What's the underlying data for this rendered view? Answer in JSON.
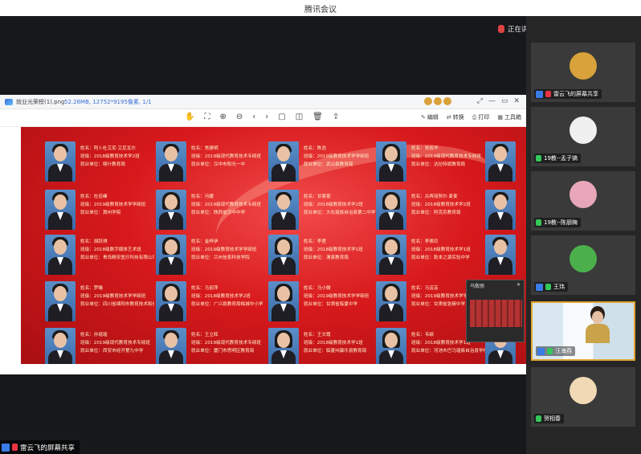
{
  "app": {
    "title": "腾讯会议"
  },
  "speaking": {
    "label": "正在讲话: 汪海燕;"
  },
  "viewer": {
    "file_name": "就业光荣榜(1).png",
    "file_meta": "52.26MB, 12752*9195像素, 1/1",
    "window_controls": [
      "⤢",
      "—",
      "▭",
      "✕"
    ],
    "toolbar_icons": [
      "✋",
      "⛶",
      "⊕",
      "⊖",
      "‹",
      "›",
      "▢",
      "◫",
      "🗑",
      "⇪"
    ],
    "actions": [
      {
        "icon": "✎",
        "label": "编辑"
      },
      {
        "icon": "⇄",
        "label": "转换"
      },
      {
        "icon": "⎙",
        "label": "打印"
      },
      {
        "icon": "▦",
        "label": "工具箱"
      }
    ]
  },
  "poster": {
    "cards": [
      {
        "name": "姓名：阿卜杜艾尼·艾尼瓦尔",
        "class": "班级：2018级教育技术学2班",
        "unit": "就业单位：喀什教育局"
      },
      {
        "name": "姓名：常建明",
        "class": "班级：2019级现代教育技术专硕班",
        "unit": "就业单位：汉中市阳光一中"
      },
      {
        "name": "姓名：陈浩",
        "class": "班级：2019级教育技术学学硕班",
        "unit": "就业单位：武山县教育局"
      },
      {
        "name": "姓名：党若华",
        "class": "班级：2019级现代教育技术专硕班",
        "unit": "就业单位：达拉特旗教育局"
      },
      {
        "name": "姓名：杜佳峰",
        "class": "班级：2019级教育技术学学硕班",
        "unit": "就业单位：滁州学院"
      },
      {
        "name": "姓名：冯媛",
        "class": "班级：2019级现代教育技术专硕班",
        "unit": "就业单位：陕西省汉中中学"
      },
      {
        "name": "姓名：甘豪豪",
        "class": "班级：2018级教育技术学2班",
        "unit": "就业单位：大化瑶族自治县第二中学（西校区）"
      },
      {
        "name": "姓名：古再丽努尔·麦麦",
        "class": "班级：2018级教育技术学2班",
        "unit": "就业单位：阿克苏教育局"
      },
      {
        "name": "姓名：胡跃琪",
        "class": "班级：2018级数字媒体艺术班",
        "unit": "就业单位：青岛精安医疗科技有限公司"
      },
      {
        "name": "姓名：金梓伊",
        "class": "班级：2019级教育技术学学硕班",
        "unit": "就业单位：兰州信息科技学院"
      },
      {
        "name": "姓名：李君",
        "class": "班级：2018级教育技术学1班",
        "unit": "就业单位：渭县教育局"
      },
      {
        "name": "姓名：李佩玲",
        "class": "班级：2018级教育技术学1班",
        "unit": "就业单位：乾本之源实验中学"
      },
      {
        "name": "姓名：罗曦",
        "class": "班级：2019级教育技术学学硕班",
        "unit": "就业单位：四川省绵阳市教育技术和信息管理中心"
      },
      {
        "name": "姓名：马丽萍",
        "class": "班级：2018级教育技术学2班",
        "unit": "就业单位：广兴县教育局梅城中小学"
      },
      {
        "name": "姓名：马小微",
        "class": "班级：2019级教育技术学学硕班",
        "unit": "就业单位：甘肃省临夏中学"
      },
      {
        "name": "姓名：马芸芸",
        "class": "班级：2019级教育技术学学硕班",
        "unit": "就业单位：甘肃省张掖中学"
      },
      {
        "name": "姓名：孙瑶瑶",
        "class": "班级：2019级现代教育技术专硕班",
        "unit": "就业单位：西安市经开第九中学"
      },
      {
        "name": "姓名：王立辉",
        "class": "班级：2019级现代教育技术专硕班",
        "unit": "就业单位：厦门市思明区教育局"
      },
      {
        "name": "姓名：王文霞",
        "class": "班级：2018级教育技术学1班",
        "unit": "就业单位：临夏州康乐县教育局"
      },
      {
        "name": "姓名：韦颖",
        "class": "班级：2018级教育技术学1班",
        "unit": "就业单位：河池市巴马瑶族自治县学校（河池巴马瑶族自治县学校）"
      }
    ],
    "floating_window": {
      "title": "乌敬丽"
    }
  },
  "participants": [
    {
      "name": "雷云飞的屏幕共享",
      "mic": "off",
      "pinned": true,
      "avatar_color": "#d9a23a"
    },
    {
      "name": "19教--孟子镐",
      "mic": "on",
      "pinned": false,
      "avatar_color": "#f0f0f0"
    },
    {
      "name": "19教--陈朋梅",
      "mic": "on",
      "pinned": false,
      "avatar_color": "#e8a7b8"
    },
    {
      "name": "王玮",
      "mic": "on",
      "pinned": true,
      "avatar_color": "#4bb04b"
    },
    {
      "name": "汪海燕",
      "mic": "on",
      "pinned": true,
      "avatar_color": "#c9a24a",
      "active": true
    },
    {
      "name": "贺相春",
      "mic": "on",
      "pinned": false,
      "avatar_color": "#f1d9b5"
    }
  ],
  "bottom_label": "雷云飞的屏幕共享"
}
